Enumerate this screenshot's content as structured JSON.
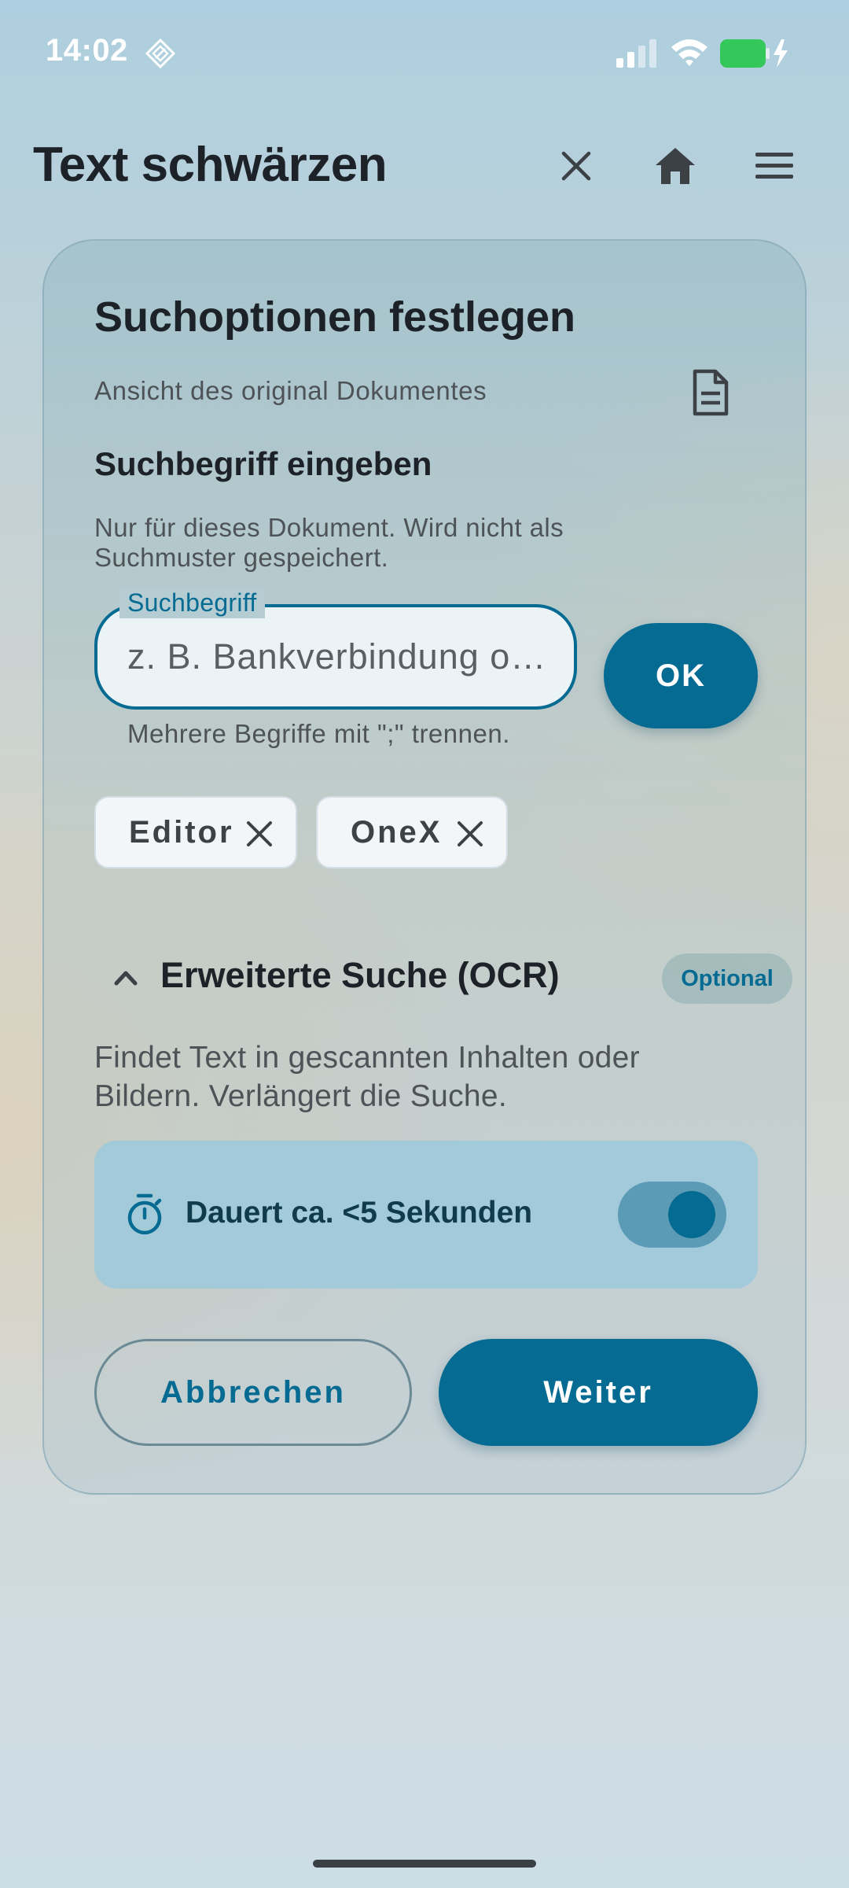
{
  "status_bar": {
    "time": "14:02",
    "battery_color": "#34c759"
  },
  "header": {
    "title": "Text schwärzen",
    "icons": [
      "close-icon",
      "home-icon",
      "menu-icon"
    ]
  },
  "card": {
    "title": "Suchoptionen festlegen",
    "document_view_label": "Ansicht des original Dokumentes",
    "search_section": {
      "heading": "Suchbegriff eingeben",
      "description": "Nur für dieses Dokument. Wird nicht als Suchmuster gespeichert.",
      "field_label": "Suchbegriff",
      "placeholder": "z. B. Bankverbindung o…",
      "value": "",
      "ok_label": "OK",
      "helper": "Mehrere Begriffe mit \";\" trennen."
    },
    "chips": [
      {
        "label": "Editor"
      },
      {
        "label": "OneX"
      }
    ],
    "advanced": {
      "title": "Erweiterte Suche (OCR)",
      "badge": "Optional",
      "expanded": true,
      "description": "Findet Text in gescannten Inhalten oder Bildern. Verlängert die Suche.",
      "duration_text": "Dauert ca. <5 Sekunden",
      "ocr_enabled": true
    },
    "buttons": {
      "cancel": "Abbrechen",
      "next": "Weiter"
    }
  },
  "colors": {
    "primary": "#066b92",
    "text": "#1c2227",
    "secondary_text": "#4d5357"
  }
}
